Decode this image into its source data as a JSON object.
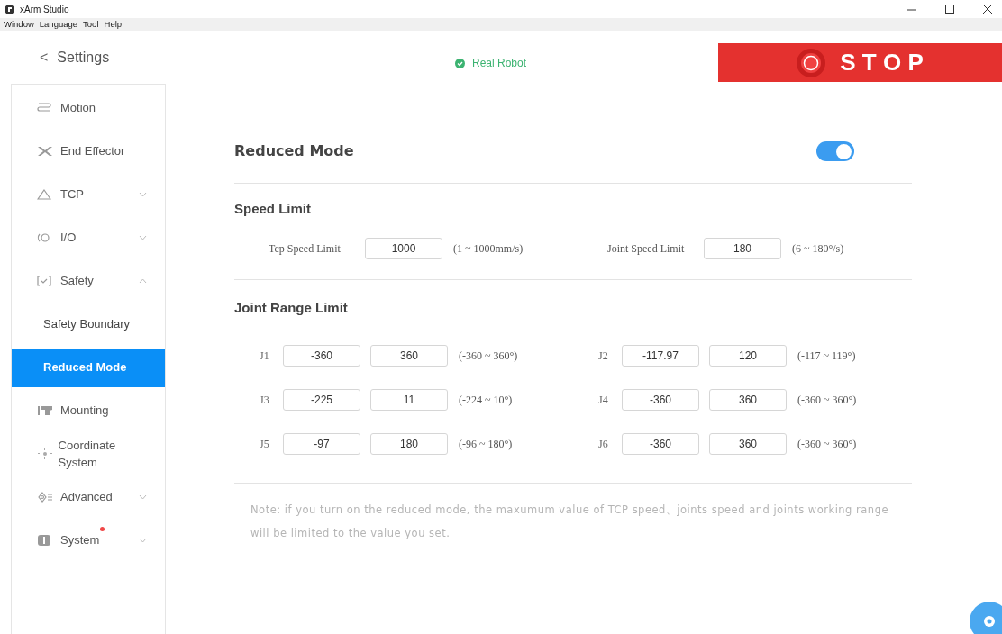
{
  "window": {
    "title": "xArm Studio"
  },
  "menu": [
    "Window",
    "Language",
    "Tool",
    "Help"
  ],
  "header": {
    "back": "<",
    "title": "Settings",
    "status": "Real Robot",
    "stop": "S T O P"
  },
  "sidebar": {
    "items": [
      {
        "label": "Motion",
        "kind": "link",
        "selected": false,
        "notification": false
      },
      {
        "label": "End Effector",
        "kind": "link",
        "selected": false,
        "notification": false
      },
      {
        "label": "TCP",
        "kind": "group",
        "expanded": false,
        "selected": false,
        "notification": false
      },
      {
        "label": "I/O",
        "kind": "group",
        "expanded": false,
        "selected": false,
        "notification": false
      },
      {
        "label": "Safety",
        "kind": "group",
        "expanded": true,
        "selected": false,
        "notification": false
      },
      {
        "label": "Safety Boundary",
        "kind": "sub",
        "selected": false
      },
      {
        "label": "Reduced Mode",
        "kind": "sub",
        "selected": true
      },
      {
        "label": "Mounting",
        "kind": "link",
        "selected": false,
        "notification": false
      },
      {
        "label": "Coordinate System",
        "kind": "link",
        "selected": false,
        "notification": false
      },
      {
        "label": "Advanced",
        "kind": "group",
        "expanded": false,
        "selected": false,
        "notification": false
      },
      {
        "label": "System",
        "kind": "group",
        "expanded": false,
        "selected": false,
        "notification": true
      }
    ]
  },
  "reduced_mode": {
    "title": "Reduced Mode",
    "on": true
  },
  "speed_limit": {
    "title": "Speed Limit",
    "fields": [
      {
        "label": "Tcp Speed Limit",
        "value": "1000",
        "range": "(1 ~ 1000mm/s)"
      },
      {
        "label": "Joint Speed Limit",
        "value": "180",
        "range": "(6 ~ 180°/s)"
      }
    ]
  },
  "joint_range": {
    "title": "Joint Range Limit",
    "joints": [
      {
        "name": "J1",
        "min": "-360",
        "max": "360",
        "range": "(-360 ~ 360°)"
      },
      {
        "name": "J2",
        "min": "-117.97",
        "max": "120",
        "range": "(-117 ~ 119°)"
      },
      {
        "name": "J3",
        "min": "-225",
        "max": "11",
        "range": "(-224 ~ 10°)"
      },
      {
        "name": "J4",
        "min": "-360",
        "max": "360",
        "range": "(-360 ~ 360°)"
      },
      {
        "name": "J5",
        "min": "-97",
        "max": "180",
        "range": "(-96 ~ 180°)"
      },
      {
        "name": "J6",
        "min": "-360",
        "max": "360",
        "range": "(-360 ~ 360°)"
      }
    ]
  },
  "note": "Note: if you turn on the reduced mode, the maxumum value of TCP speed、joints speed and joints working range will be limited to the value you set."
}
